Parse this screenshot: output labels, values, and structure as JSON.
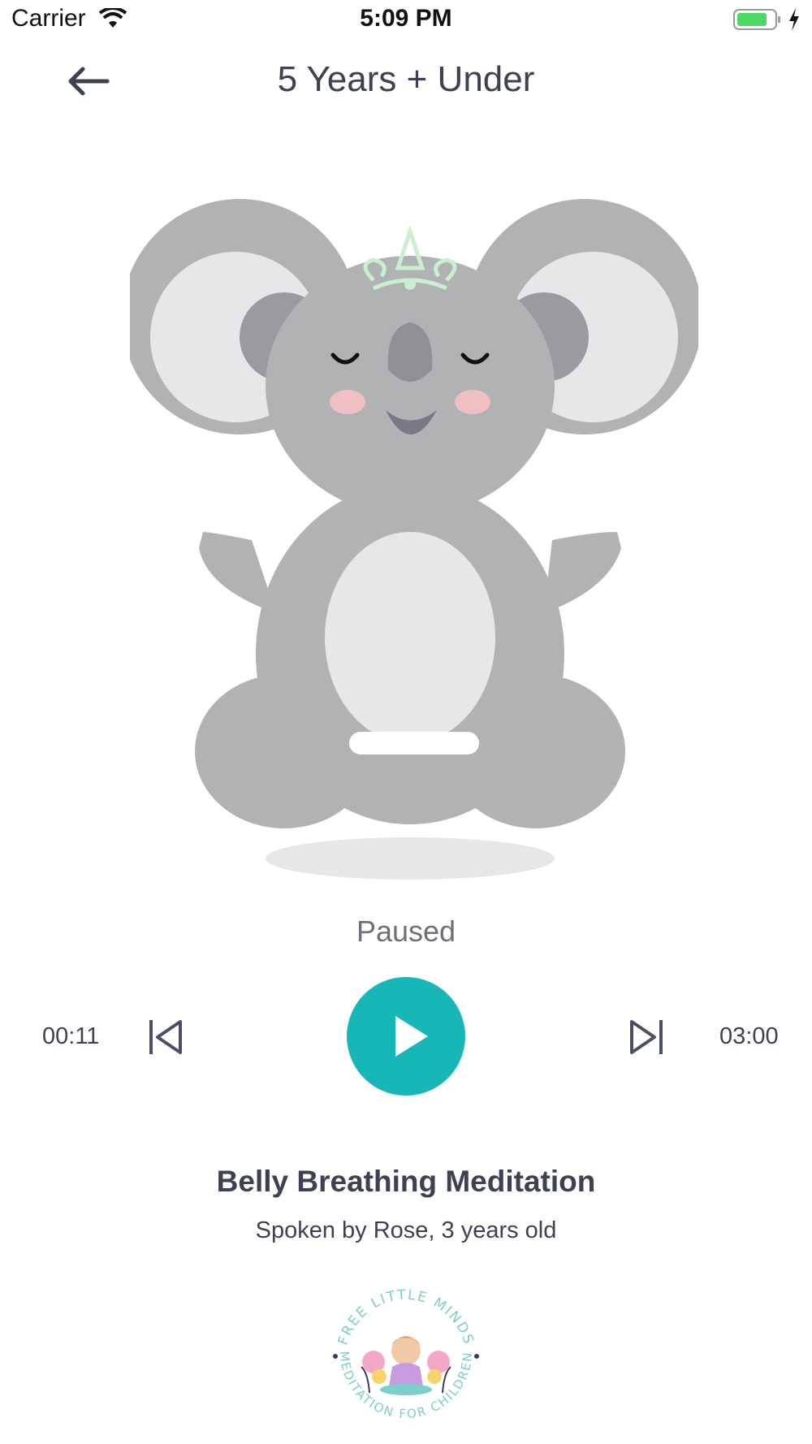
{
  "status_bar": {
    "carrier": "Carrier",
    "time": "5:09 PM",
    "battery_color": "#4cd964"
  },
  "header": {
    "title": "5 Years + Under",
    "back_icon": "arrow-left-icon"
  },
  "player": {
    "state": "Paused",
    "elapsed": "00:11",
    "total": "03:00",
    "accent": "#17b6b7"
  },
  "track": {
    "title": "Belly Breathing Meditation",
    "subtitle": "Spoken by Rose, 3 years old"
  },
  "logo": {
    "top_text": "FREE LITTLE MINDS",
    "bottom_text": "MEDITATION FOR CHILDREN"
  }
}
